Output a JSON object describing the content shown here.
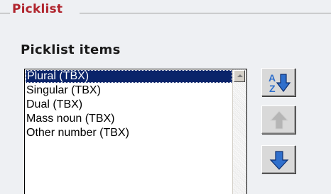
{
  "picklist": {
    "legend": "Picklist",
    "items_label": "Picklist items",
    "items": [
      {
        "label": "Plural (TBX)",
        "selected": true
      },
      {
        "label": "Singular (TBX)",
        "selected": false
      },
      {
        "label": "Dual (TBX)",
        "selected": false
      },
      {
        "label": "Mass noun (TBX)",
        "selected": false
      },
      {
        "label": "Other number (TBX)",
        "selected": false
      }
    ]
  },
  "toolbar": {
    "sort_button": {
      "icon": "sort-az-icon",
      "enabled": true
    },
    "move_up_button": {
      "icon": "arrow-up-icon",
      "enabled": false
    },
    "move_down_button": {
      "icon": "arrow-down-icon",
      "enabled": true
    }
  },
  "colors": {
    "legend": "#b0242d",
    "selection": "#0a246a",
    "arrow_blue": "#2f6fcc",
    "arrow_disabled": "#b5b5b5"
  }
}
